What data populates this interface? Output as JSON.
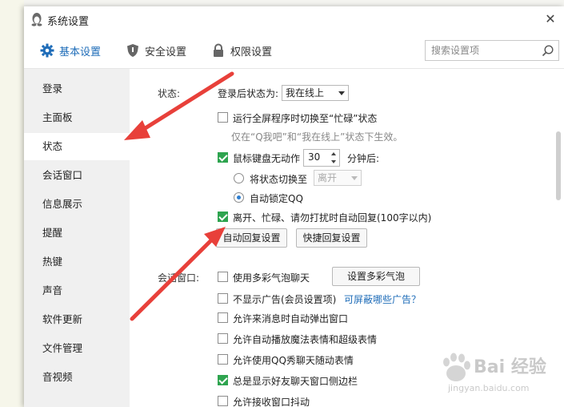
{
  "window": {
    "title": "系统设置",
    "close_glyph": "✕"
  },
  "tabs": [
    {
      "label": "基本设置",
      "icon": "gear-icon",
      "active": true
    },
    {
      "label": "安全设置",
      "icon": "shield-icon",
      "active": false
    },
    {
      "label": "权限设置",
      "icon": "lock-icon",
      "active": false
    }
  ],
  "search": {
    "placeholder": "搜索设置项",
    "icon": "search-icon"
  },
  "sidebar": {
    "items": [
      {
        "label": "登录"
      },
      {
        "label": "主面板"
      },
      {
        "label": "状态",
        "active": true
      },
      {
        "label": "会话窗口"
      },
      {
        "label": "信息展示"
      },
      {
        "label": "提醒"
      },
      {
        "label": "热键"
      },
      {
        "label": "声音"
      },
      {
        "label": "软件更新"
      },
      {
        "label": "文件管理"
      },
      {
        "label": "音视频"
      }
    ]
  },
  "status_section": {
    "label": "状态:",
    "after_login_label": "登录后状态为:",
    "after_login_value": "我在线上",
    "fullscreen_busy": {
      "label": "运行全屏程序时切换至“忙碌”状态",
      "checked": false
    },
    "fullscreen_hint": "仅在“Q我吧”和“我在线上”状态下生效。",
    "idle": {
      "label": "鼠标键盘无动作",
      "checked": true,
      "minutes": "30",
      "suffix": "分钟后:"
    },
    "switch_to": {
      "label": "将状态切换至",
      "value": "离开",
      "selected": false
    },
    "auto_lock": {
      "label": "自动锁定QQ",
      "selected": true
    },
    "auto_reply": {
      "label": "离开、忙碌、请勿打扰时自动回复(100字以内)",
      "checked": true
    },
    "auto_reply_button": "自动回复设置",
    "quick_reply_button": "快捷回复设置"
  },
  "session_section": {
    "label": "会话窗口:",
    "bubble": {
      "label": "使用多彩气泡聊天",
      "checked": false,
      "button": "设置多彩气泡"
    },
    "no_ads": {
      "label": "不显示广告(会员设置项)",
      "checked": false,
      "link": "可屏蔽哪些广告？"
    },
    "popup": {
      "label": "允许来消息时自动弹出窗口",
      "checked": false
    },
    "magic": {
      "label": "允许自动播放魔法表情和超级表情",
      "checked": false
    },
    "qq_show": {
      "label": "允许使用QQ秀聊天随动表情",
      "checked": false
    },
    "sidebar_show": {
      "label": "总是显示好友聊天窗口侧边栏",
      "checked": true
    },
    "shake": {
      "label": "允许接收窗口抖动",
      "checked": false
    }
  },
  "watermark": {
    "text": "Bai 经验",
    "sub": "jingyan.baidu.com"
  },
  "colors": {
    "accent": "#1e6cb8",
    "checkbox_checked": "#2ea44f",
    "arrow": "#e8403a",
    "sidebar_bg": "#f0f0f0"
  }
}
